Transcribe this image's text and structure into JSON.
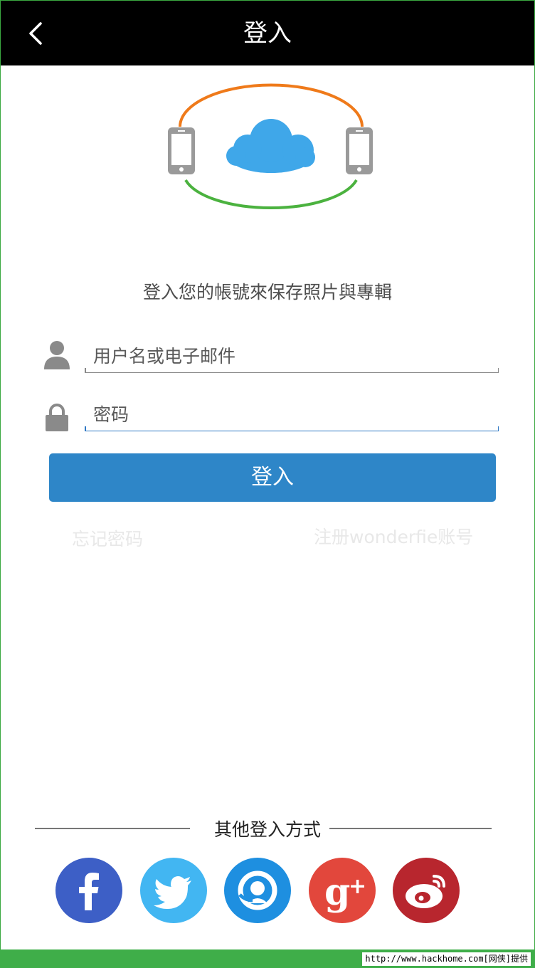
{
  "header": {
    "title": "登入"
  },
  "tagline": "登入您的帳號來保存照片與專輯",
  "form": {
    "username_placeholder": "用户名或电子邮件",
    "password_placeholder": "密码",
    "login_label": "登入"
  },
  "links": {
    "forgot": "忘记密码",
    "register": "注册wonderfie账号"
  },
  "other_login": {
    "label": "其他登入方式",
    "services": [
      "facebook",
      "twitter",
      "qq",
      "google-plus",
      "weibo"
    ]
  },
  "colors": {
    "accent": "#2e86c8",
    "facebook": "#3d5fc6",
    "twitter": "#42b6f2",
    "qq": "#1e8fe0",
    "google_plus": "#e2473c",
    "weibo": "#b8262e"
  },
  "watermark": "http://www.hackhome.com[网侠]提供"
}
